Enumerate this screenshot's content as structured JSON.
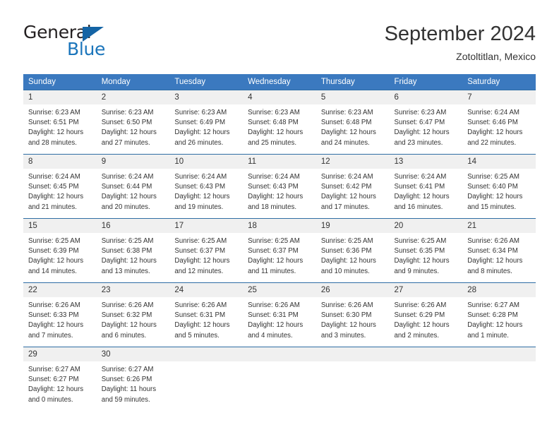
{
  "logo": {
    "word_one": "General",
    "word_two": "Blue",
    "triangle_icon": "triangle-icon",
    "blue_hex": "#1b75bb",
    "dark_hex": "#231f20"
  },
  "header": {
    "title": "September 2024",
    "subtitle": "Zotoltitlan, Mexico"
  },
  "calendar": {
    "header_bg": "#3b79bf",
    "header_text": "#ffffff",
    "daynum_bg": "#f0f0f0",
    "border_color": "#2e6da4",
    "weekday_headers": [
      "Sunday",
      "Monday",
      "Tuesday",
      "Wednesday",
      "Thursday",
      "Friday",
      "Saturday"
    ],
    "weeks": [
      [
        {
          "day": "1",
          "sunrise": "Sunrise: 6:23 AM",
          "sunset": "Sunset: 6:51 PM",
          "daylight_1": "Daylight: 12 hours",
          "daylight_2": "and 28 minutes."
        },
        {
          "day": "2",
          "sunrise": "Sunrise: 6:23 AM",
          "sunset": "Sunset: 6:50 PM",
          "daylight_1": "Daylight: 12 hours",
          "daylight_2": "and 27 minutes."
        },
        {
          "day": "3",
          "sunrise": "Sunrise: 6:23 AM",
          "sunset": "Sunset: 6:49 PM",
          "daylight_1": "Daylight: 12 hours",
          "daylight_2": "and 26 minutes."
        },
        {
          "day": "4",
          "sunrise": "Sunrise: 6:23 AM",
          "sunset": "Sunset: 6:48 PM",
          "daylight_1": "Daylight: 12 hours",
          "daylight_2": "and 25 minutes."
        },
        {
          "day": "5",
          "sunrise": "Sunrise: 6:23 AM",
          "sunset": "Sunset: 6:48 PM",
          "daylight_1": "Daylight: 12 hours",
          "daylight_2": "and 24 minutes."
        },
        {
          "day": "6",
          "sunrise": "Sunrise: 6:23 AM",
          "sunset": "Sunset: 6:47 PM",
          "daylight_1": "Daylight: 12 hours",
          "daylight_2": "and 23 minutes."
        },
        {
          "day": "7",
          "sunrise": "Sunrise: 6:24 AM",
          "sunset": "Sunset: 6:46 PM",
          "daylight_1": "Daylight: 12 hours",
          "daylight_2": "and 22 minutes."
        }
      ],
      [
        {
          "day": "8",
          "sunrise": "Sunrise: 6:24 AM",
          "sunset": "Sunset: 6:45 PM",
          "daylight_1": "Daylight: 12 hours",
          "daylight_2": "and 21 minutes."
        },
        {
          "day": "9",
          "sunrise": "Sunrise: 6:24 AM",
          "sunset": "Sunset: 6:44 PM",
          "daylight_1": "Daylight: 12 hours",
          "daylight_2": "and 20 minutes."
        },
        {
          "day": "10",
          "sunrise": "Sunrise: 6:24 AM",
          "sunset": "Sunset: 6:43 PM",
          "daylight_1": "Daylight: 12 hours",
          "daylight_2": "and 19 minutes."
        },
        {
          "day": "11",
          "sunrise": "Sunrise: 6:24 AM",
          "sunset": "Sunset: 6:43 PM",
          "daylight_1": "Daylight: 12 hours",
          "daylight_2": "and 18 minutes."
        },
        {
          "day": "12",
          "sunrise": "Sunrise: 6:24 AM",
          "sunset": "Sunset: 6:42 PM",
          "daylight_1": "Daylight: 12 hours",
          "daylight_2": "and 17 minutes."
        },
        {
          "day": "13",
          "sunrise": "Sunrise: 6:24 AM",
          "sunset": "Sunset: 6:41 PM",
          "daylight_1": "Daylight: 12 hours",
          "daylight_2": "and 16 minutes."
        },
        {
          "day": "14",
          "sunrise": "Sunrise: 6:25 AM",
          "sunset": "Sunset: 6:40 PM",
          "daylight_1": "Daylight: 12 hours",
          "daylight_2": "and 15 minutes."
        }
      ],
      [
        {
          "day": "15",
          "sunrise": "Sunrise: 6:25 AM",
          "sunset": "Sunset: 6:39 PM",
          "daylight_1": "Daylight: 12 hours",
          "daylight_2": "and 14 minutes."
        },
        {
          "day": "16",
          "sunrise": "Sunrise: 6:25 AM",
          "sunset": "Sunset: 6:38 PM",
          "daylight_1": "Daylight: 12 hours",
          "daylight_2": "and 13 minutes."
        },
        {
          "day": "17",
          "sunrise": "Sunrise: 6:25 AM",
          "sunset": "Sunset: 6:37 PM",
          "daylight_1": "Daylight: 12 hours",
          "daylight_2": "and 12 minutes."
        },
        {
          "day": "18",
          "sunrise": "Sunrise: 6:25 AM",
          "sunset": "Sunset: 6:37 PM",
          "daylight_1": "Daylight: 12 hours",
          "daylight_2": "and 11 minutes."
        },
        {
          "day": "19",
          "sunrise": "Sunrise: 6:25 AM",
          "sunset": "Sunset: 6:36 PM",
          "daylight_1": "Daylight: 12 hours",
          "daylight_2": "and 10 minutes."
        },
        {
          "day": "20",
          "sunrise": "Sunrise: 6:25 AM",
          "sunset": "Sunset: 6:35 PM",
          "daylight_1": "Daylight: 12 hours",
          "daylight_2": "and 9 minutes."
        },
        {
          "day": "21",
          "sunrise": "Sunrise: 6:26 AM",
          "sunset": "Sunset: 6:34 PM",
          "daylight_1": "Daylight: 12 hours",
          "daylight_2": "and 8 minutes."
        }
      ],
      [
        {
          "day": "22",
          "sunrise": "Sunrise: 6:26 AM",
          "sunset": "Sunset: 6:33 PM",
          "daylight_1": "Daylight: 12 hours",
          "daylight_2": "and 7 minutes."
        },
        {
          "day": "23",
          "sunrise": "Sunrise: 6:26 AM",
          "sunset": "Sunset: 6:32 PM",
          "daylight_1": "Daylight: 12 hours",
          "daylight_2": "and 6 minutes."
        },
        {
          "day": "24",
          "sunrise": "Sunrise: 6:26 AM",
          "sunset": "Sunset: 6:31 PM",
          "daylight_1": "Daylight: 12 hours",
          "daylight_2": "and 5 minutes."
        },
        {
          "day": "25",
          "sunrise": "Sunrise: 6:26 AM",
          "sunset": "Sunset: 6:31 PM",
          "daylight_1": "Daylight: 12 hours",
          "daylight_2": "and 4 minutes."
        },
        {
          "day": "26",
          "sunrise": "Sunrise: 6:26 AM",
          "sunset": "Sunset: 6:30 PM",
          "daylight_1": "Daylight: 12 hours",
          "daylight_2": "and 3 minutes."
        },
        {
          "day": "27",
          "sunrise": "Sunrise: 6:26 AM",
          "sunset": "Sunset: 6:29 PM",
          "daylight_1": "Daylight: 12 hours",
          "daylight_2": "and 2 minutes."
        },
        {
          "day": "28",
          "sunrise": "Sunrise: 6:27 AM",
          "sunset": "Sunset: 6:28 PM",
          "daylight_1": "Daylight: 12 hours",
          "daylight_2": "and 1 minute."
        }
      ],
      [
        {
          "day": "29",
          "sunrise": "Sunrise: 6:27 AM",
          "sunset": "Sunset: 6:27 PM",
          "daylight_1": "Daylight: 12 hours",
          "daylight_2": "and 0 minutes."
        },
        {
          "day": "30",
          "sunrise": "Sunrise: 6:27 AM",
          "sunset": "Sunset: 6:26 PM",
          "daylight_1": "Daylight: 11 hours",
          "daylight_2": "and 59 minutes."
        },
        {
          "day": "",
          "sunrise": "",
          "sunset": "",
          "daylight_1": "",
          "daylight_2": ""
        },
        {
          "day": "",
          "sunrise": "",
          "sunset": "",
          "daylight_1": "",
          "daylight_2": ""
        },
        {
          "day": "",
          "sunrise": "",
          "sunset": "",
          "daylight_1": "",
          "daylight_2": ""
        },
        {
          "day": "",
          "sunrise": "",
          "sunset": "",
          "daylight_1": "",
          "daylight_2": ""
        },
        {
          "day": "",
          "sunrise": "",
          "sunset": "",
          "daylight_1": "",
          "daylight_2": ""
        }
      ]
    ]
  }
}
